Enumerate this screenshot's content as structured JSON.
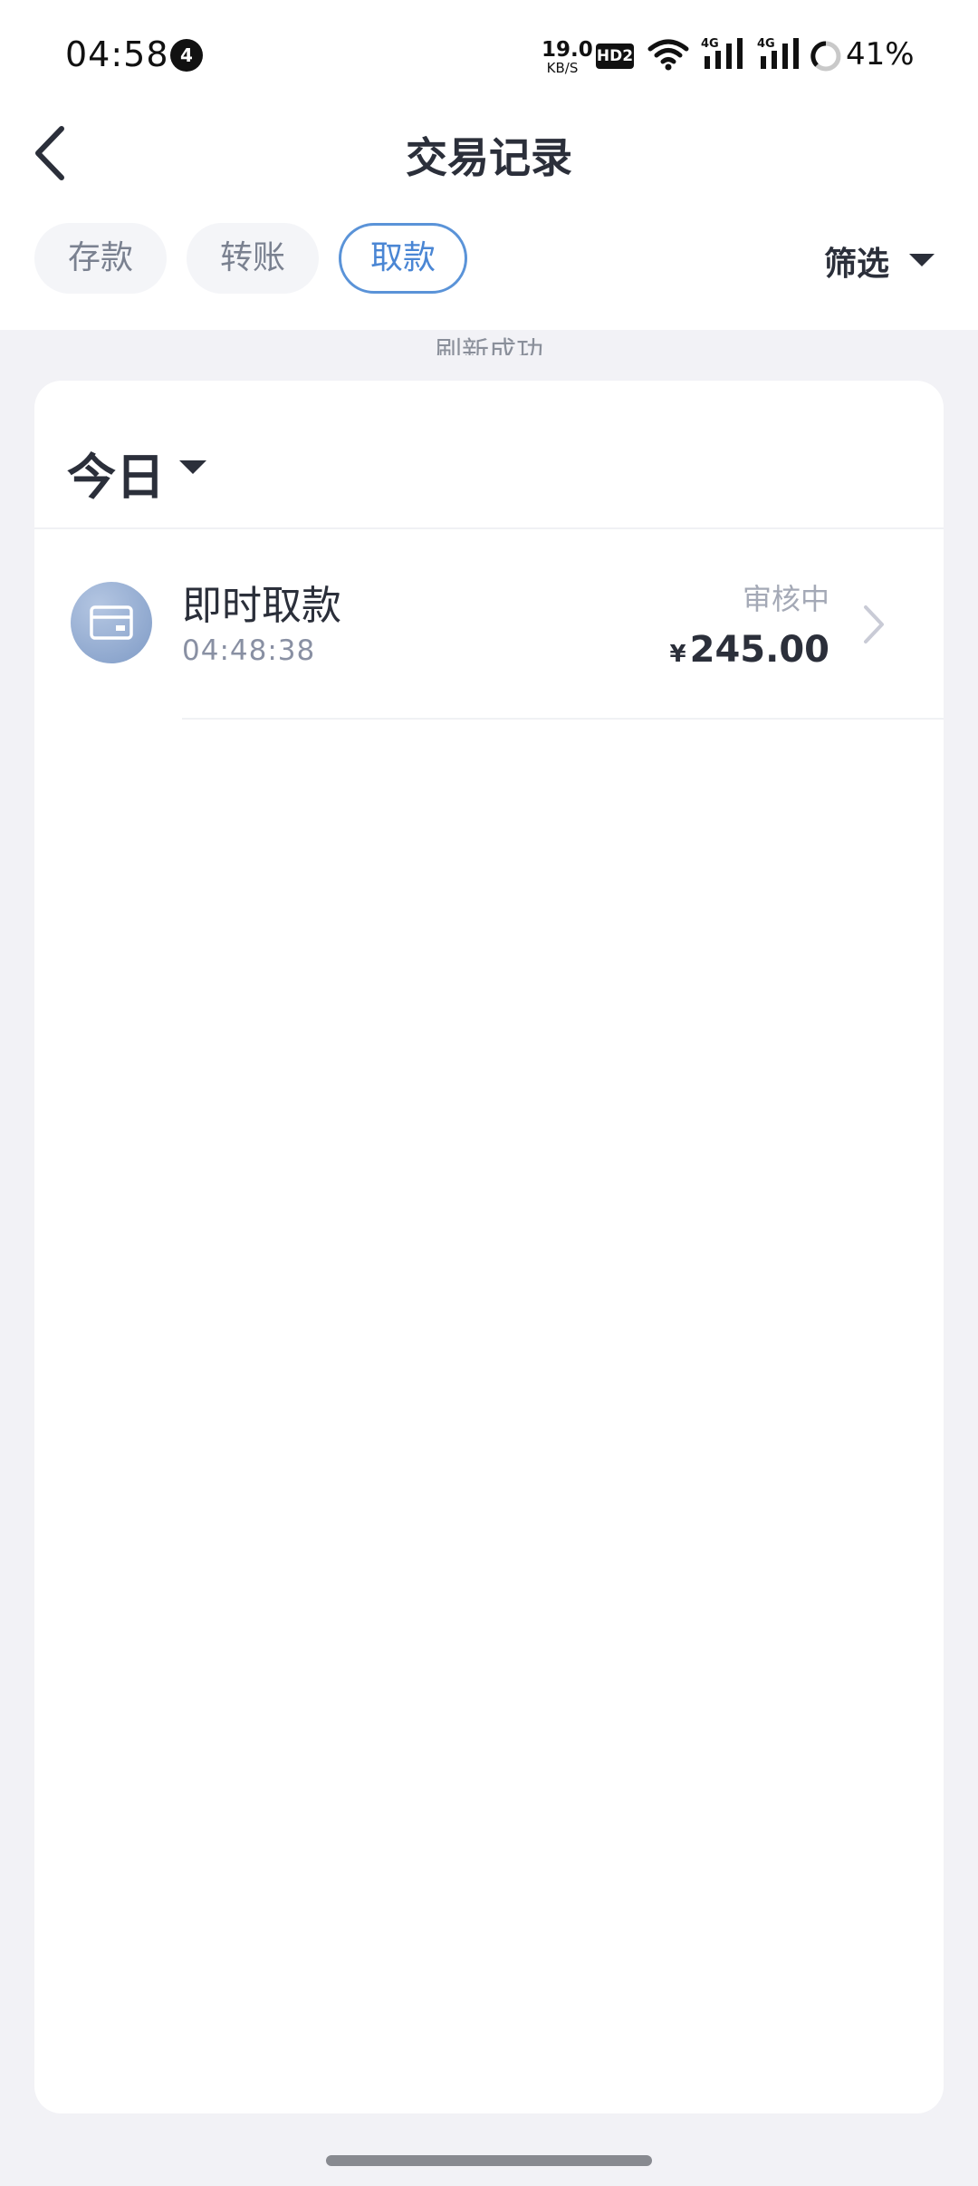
{
  "status_bar": {
    "time": "04:58",
    "notification_count": "4",
    "net_speed": "19.0",
    "net_speed_unit": "KB/S",
    "hd_label": "HD2",
    "signal1_label": "4G",
    "signal2_label": "4G",
    "battery_percent": "41%"
  },
  "header": {
    "title": "交易记录",
    "back_icon": "chevron-left-icon"
  },
  "tabs": [
    {
      "label": "存款",
      "active": false
    },
    {
      "label": "转账",
      "active": false
    },
    {
      "label": "取款",
      "active": true
    }
  ],
  "filter": {
    "label": "筛选"
  },
  "refresh_tip": "刷新成功",
  "section": {
    "date_label": "今日"
  },
  "transactions": [
    {
      "title": "即时取款",
      "time": "04:48:38",
      "status": "审核中",
      "currency": "¥",
      "amount": "245.00",
      "icon": "card-icon"
    }
  ],
  "colors": {
    "accent": "#4a86d4",
    "text_primary": "#2b2f3a",
    "text_secondary": "#8990a3",
    "page_bg": "#f2f2f6"
  }
}
